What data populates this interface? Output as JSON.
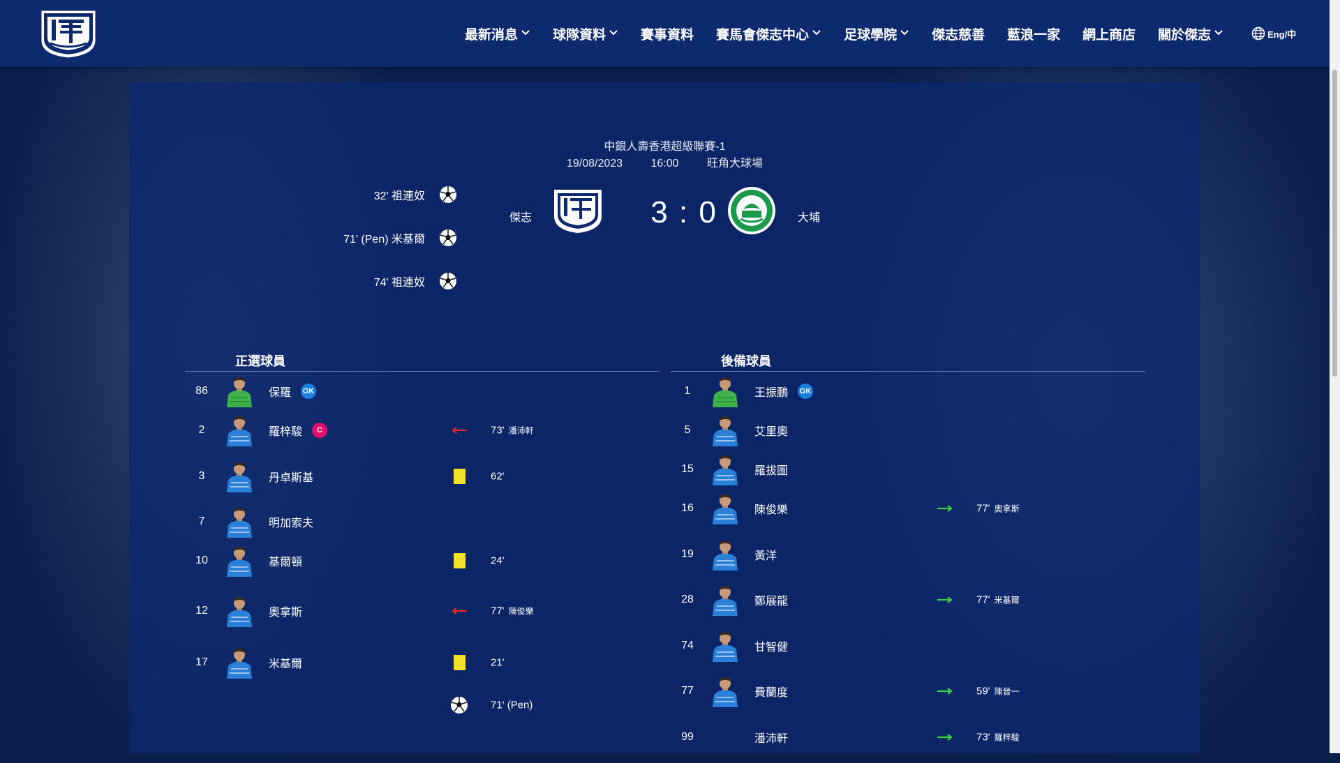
{
  "nav": {
    "items": [
      {
        "label": "最新消息",
        "dropdown": true
      },
      {
        "label": "球隊資料",
        "dropdown": true
      },
      {
        "label": "賽事資料",
        "dropdown": false
      },
      {
        "label": "賽馬會傑志中心",
        "dropdown": true
      },
      {
        "label": "足球學院",
        "dropdown": true
      },
      {
        "label": "傑志慈善",
        "dropdown": false
      },
      {
        "label": "藍浪一家",
        "dropdown": false
      },
      {
        "label": "網上商店",
        "dropdown": false
      },
      {
        "label": "關於傑志",
        "dropdown": true
      }
    ],
    "lang_label": "Eng/中"
  },
  "match": {
    "competition": "中銀人壽香港超級聯賽-1",
    "date": "19/08/2023",
    "time": "16:00",
    "venue": "旺角大球場",
    "home": "傑志",
    "away": "大埔",
    "score": "3 : 0"
  },
  "goals": [
    {
      "text": "32'  祖連奴"
    },
    {
      "text": "71' (Pen)  米基爾"
    },
    {
      "text": "74'  祖連奴"
    }
  ],
  "lineups": {
    "start_title": "正選球員",
    "sub_title": "後備球員",
    "starters": [
      {
        "num": "86",
        "name": "保羅",
        "badge": "GK",
        "event": "",
        "time": "",
        "other": "",
        "kit": "gk"
      },
      {
        "num": "2",
        "name": "羅梓駿",
        "badge": "C",
        "event": "sub-out",
        "time": "73'",
        "other": "潘沛軒",
        "kit": "field"
      },
      {
        "num": "3",
        "name": "丹卓斯基",
        "badge": "",
        "event": "yellow",
        "time": "62'",
        "other": "",
        "kit": "field"
      },
      {
        "num": "7",
        "name": "明加索夫",
        "badge": "",
        "event": "",
        "time": "",
        "other": "",
        "kit": "field"
      },
      {
        "num": "10",
        "name": "基爾頓",
        "badge": "",
        "event": "yellow",
        "time": "24'",
        "other": "",
        "kit": "field"
      },
      {
        "num": "12",
        "name": "奧拿斯",
        "badge": "",
        "event": "sub-out",
        "time": "77'",
        "other": "陳俊樂",
        "kit": "field"
      },
      {
        "num": "17",
        "name": "米基爾",
        "badge": "",
        "event": "yellow",
        "time": "21'",
        "other": "",
        "kit": "field"
      },
      {
        "num": "",
        "name": "",
        "badge": "",
        "event": "goal",
        "time": "71' (Pen)",
        "other": "",
        "kit": "none"
      }
    ],
    "subs": [
      {
        "num": "1",
        "name": "王振鵬",
        "badge": "GK",
        "event": "",
        "time": "",
        "other": "",
        "kit": "gk"
      },
      {
        "num": "5",
        "name": "艾里奧",
        "badge": "",
        "event": "",
        "time": "",
        "other": "",
        "kit": "field"
      },
      {
        "num": "15",
        "name": "羅拔圖",
        "badge": "",
        "event": "",
        "time": "",
        "other": "",
        "kit": "field"
      },
      {
        "num": "16",
        "name": "陳俊樂",
        "badge": "",
        "event": "sub-in",
        "time": "77'",
        "other": "奧拿斯",
        "kit": "field"
      },
      {
        "num": "19",
        "name": "黃洋",
        "badge": "",
        "event": "",
        "time": "",
        "other": "",
        "kit": "field"
      },
      {
        "num": "28",
        "name": "鄭展龍",
        "badge": "",
        "event": "sub-in",
        "time": "77'",
        "other": "米基爾",
        "kit": "field"
      },
      {
        "num": "74",
        "name": "甘智健",
        "badge": "",
        "event": "",
        "time": "",
        "other": "",
        "kit": "field"
      },
      {
        "num": "77",
        "name": "費蘭度",
        "badge": "",
        "event": "sub-in",
        "time": "59'",
        "other": "陳晉一",
        "kit": "field"
      },
      {
        "num": "99",
        "name": "潘沛軒",
        "badge": "",
        "event": "sub-in",
        "time": "73'",
        "other": "羅梓駿",
        "kit": "none"
      }
    ]
  },
  "colors": {
    "header": "#0d2a6e",
    "panel": "#0b2870",
    "gk_badge": "#1b7fe0",
    "captain_badge": "#e0106e",
    "yellow_card": "#f2e12b",
    "sub_in": "#3ecf3e",
    "sub_out": "#e02a2a"
  }
}
